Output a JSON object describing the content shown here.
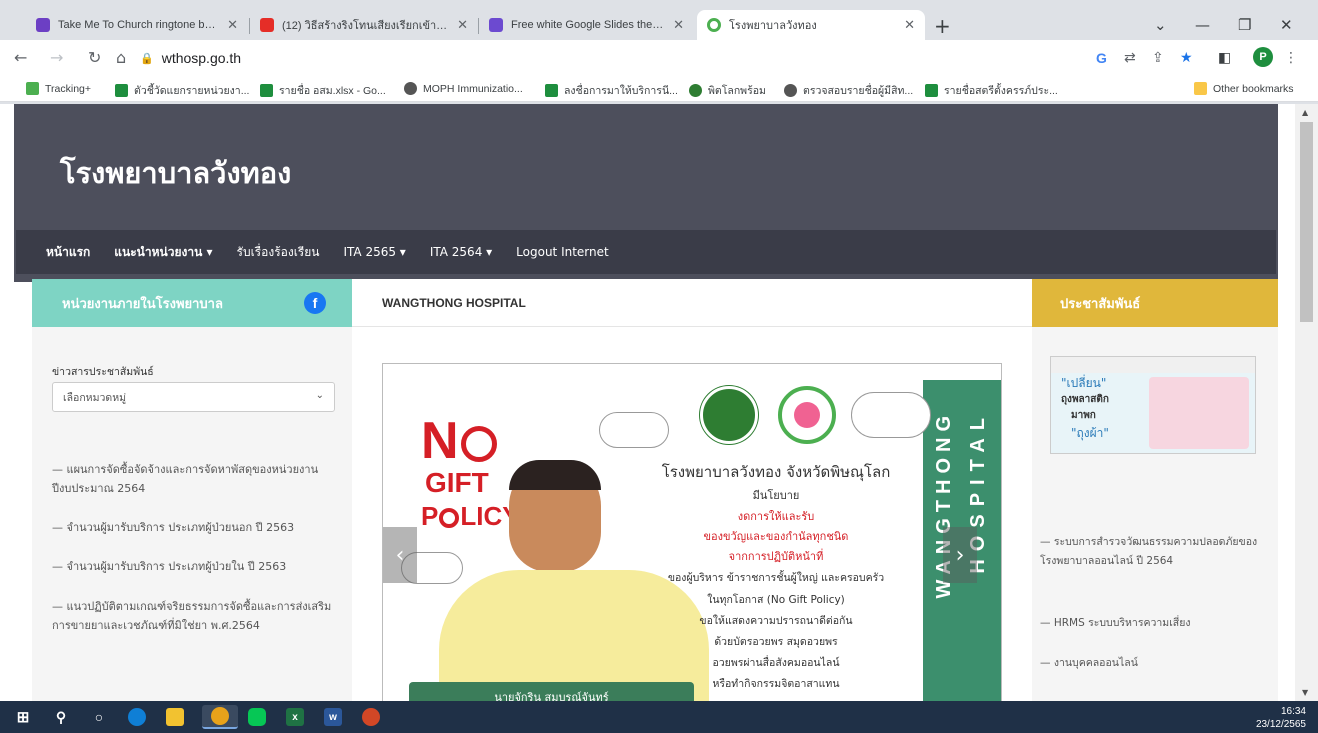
{
  "browser": {
    "tabs": [
      {
        "title": "Take Me To Church ringtone by M",
        "color": "#6c3fc4"
      },
      {
        "title": "(12) วิธีสร้างริงโทนเสียงเรียกเข้า (Ring",
        "color": "#e52d27"
      },
      {
        "title": "Free white Google Slides themes",
        "color": "#6c4ad0"
      },
      {
        "title": "โรงพยาบาลวังทอง",
        "color": "#4caf50"
      }
    ],
    "new_tab": "+",
    "url": "wthosp.go.th",
    "profile_initial": "P",
    "window_controls": {
      "minimize": "—",
      "maximize": "❐",
      "close": "✕",
      "dropdown": "⌄"
    },
    "bookmarks": [
      {
        "label": "Tracking+",
        "color": "#4caf50"
      },
      {
        "label": "ตัวชี้วัดแยกรายหน่วยงา...",
        "color": "#1e8e3e"
      },
      {
        "label": "รายชื่อ อสม.xlsx - Go...",
        "color": "#1e8e3e"
      },
      {
        "label": "MOPH Immunizatio...",
        "color": "#555555"
      },
      {
        "label": "ลงชื่อการมาให้บริการนี...",
        "color": "#1e8e3e"
      },
      {
        "label": "พิตโลกพร้อม",
        "color": "#2e7d32"
      },
      {
        "label": "ตรวจสอบรายชื่อผู้มีสิท...",
        "color": "#555555"
      },
      {
        "label": "รายชื่อสตรีตั้งครรภ์ประ...",
        "color": "#1e8e3e"
      }
    ],
    "other_bookmarks": "Other bookmarks"
  },
  "site": {
    "title": "โรงพยาบาลวังทอง",
    "menu": [
      {
        "label": "หน้าแรก",
        "bold": true
      },
      {
        "label": "แนะนำหน่วยงาน ▾",
        "bold": true
      },
      {
        "label": "รับเรื่องร้องเรียน",
        "bold": false
      },
      {
        "label": "ITA 2565 ▾",
        "bold": false
      },
      {
        "label": "ITA 2564 ▾",
        "bold": false
      },
      {
        "label": "Logout Internet",
        "bold": false
      }
    ]
  },
  "left": {
    "heading": "หน่วยงานภายในโรงพยาบาล",
    "fb_icon": "f",
    "news_label": "ข่าวสารประชาสัมพันธ์",
    "select_placeholder": "เลือกหมวดหมู่",
    "links": [
      "— แผนการจัดซื้อจัดจ้างและการจัดหาพัสดุของหน่วยงาน ปีงบประมาณ 2564",
      "— จำนวนผู้มารับบริการ ประเภทผู้ป่วยนอก ปี 2563",
      "— จำนวนผู้มารับบริการ ประเภทผู้ป่วยใน ปี 2563",
      "— แนวปฏิบัติตามเกณฑ์จริยธรรมการจัดซื้อและการส่งเสริมการขายยาและเวชภัณฑ์ที่มิใช่ยา พ.ศ.2564"
    ]
  },
  "middle": {
    "heading": "WANGTHONG HOSPITAL",
    "banner": {
      "no_gift": [
        "N",
        "GIFT",
        "P",
        "LICY"
      ],
      "vertical_left": "WANGTHONG",
      "vertical_right": "HOSPITAL",
      "lines": [
        "โรงพยาบาลวังทอง จังหวัดพิษณุโลก",
        "มีนโยบาย",
        "งดการให้และรับ",
        "ของขวัญและของกำนัลทุกชนิด",
        "จากการปฏิบัติหน้าที่",
        "ของผู้บริหาร ข้าราชการชั้นผู้ใหญ่ และครอบครัว",
        "ในทุกโอกาส (No Gift Policy)",
        "ขอให้แสดงความปรารถนาดีต่อกัน",
        "ด้วยบัตรอวยพร สมุดอวยพร",
        "อวยพรผ่านสื่อสังคมออนไลน์",
        "หรือทำกิจกรรมจิตอาสาแทน"
      ],
      "caption": "นายจักริน สมบูรณ์จันทร์",
      "prev": "‹",
      "next": "›"
    }
  },
  "right": {
    "heading": "ประชาสัมพันธ์",
    "promo_lines": [
      "\"เปลี่ยน\"",
      "ถุงพลาสติก",
      "มาพก",
      "\"ถุงผ้า\""
    ],
    "links": [
      "— ระบบการสำรวจวัฒนธรรมความปลอดภัยของโรงพยาบาลออนไลน์ ปี 2564",
      "— HRMS ระบบบริหารความเสี่ยง",
      "— งานบุคคลออนไลน์"
    ]
  },
  "taskbar": {
    "time": "16:34",
    "date": "23/12/2565"
  }
}
